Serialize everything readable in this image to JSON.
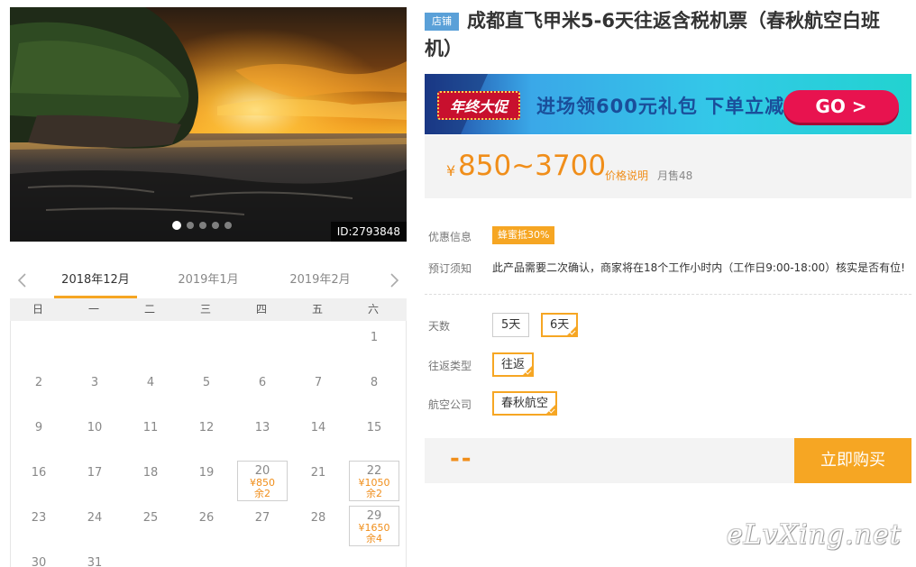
{
  "gallery": {
    "id_label": "ID:2793848",
    "dots": 5,
    "active_dot": 0
  },
  "calendar": {
    "months": [
      "2018年12月",
      "2019年1月",
      "2019年2月"
    ],
    "active_month": 0,
    "weekdays": [
      "日",
      "一",
      "二",
      "三",
      "四",
      "五",
      "六"
    ],
    "first_weekday": 6,
    "days_in_month": 31,
    "available": {
      "20": {
        "price": "¥850",
        "remain": "余2"
      },
      "22": {
        "price": "¥1050",
        "remain": "余2"
      },
      "29": {
        "price": "¥1650",
        "remain": "余4"
      }
    }
  },
  "product": {
    "shop_tag": "店铺",
    "title": "成都直飞甲米5-6天往返含税机票（春秋航空白班机）"
  },
  "banner": {
    "badge": "年终大促",
    "text_part1": "进场领",
    "text_amount": "600",
    "text_part2": "元礼包 下单立减",
    "go": "GO >"
  },
  "price": {
    "currency": "¥",
    "range": "850~3700",
    "note": "价格说明",
    "monthly_sales": "月售48"
  },
  "info": {
    "promo_label": "优惠信息",
    "promo_tag": "蜂蜜抵30%",
    "notice_label": "预订须知",
    "notice_text": "此产品需要二次确认，商家将在18个工作小时内（工作日9:00-18:00）核实是否有位!"
  },
  "options": {
    "days_label": "天数",
    "days": [
      "5天",
      "6天"
    ],
    "days_selected": 1,
    "trip_label": "往返类型",
    "trip": "往返",
    "airline_label": "航空公司",
    "airline": "春秋航空"
  },
  "purchase": {
    "total": "--",
    "button": "立即购买"
  },
  "watermark": "eLvXing.net",
  "colors": {
    "accent": "#f6a623",
    "price": "#f08e1a",
    "banner_start": "#1e3f9c",
    "banner_end": "#22d3d0",
    "go_button": "#e8134f"
  }
}
